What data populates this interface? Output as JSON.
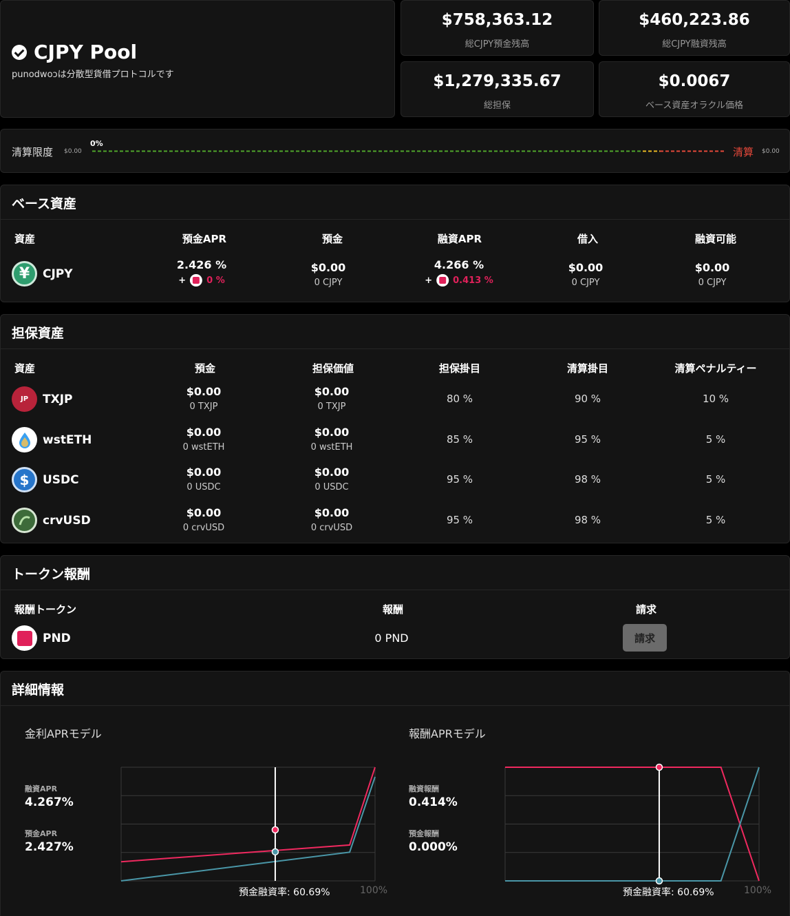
{
  "pool": {
    "name": "CJPY Pool",
    "description": "punodwoɔは分散型貨借プロトコルです"
  },
  "stats": {
    "total_supply": {
      "value": "$758,363.12",
      "label": "総CJPY預金残高"
    },
    "total_borrow": {
      "value": "$460,223.86",
      "label": "総CJPY融資残高"
    },
    "total_collateral": {
      "value": "$1,279,335.67",
      "label": "総担保"
    },
    "oracle_price": {
      "value": "$0.0067",
      "label": "ベース資産オラクル価格"
    }
  },
  "liquidation": {
    "label": "清算限度",
    "min_value": "$0.00",
    "percent": "0%",
    "end_label": "清算",
    "max_value": "$0.00"
  },
  "base_asset": {
    "title": "ベース資産",
    "headers": [
      "資産",
      "預金APR",
      "預金",
      "融資APR",
      "借入",
      "融資可能"
    ],
    "row": {
      "symbol": "CJPY",
      "icon": "yen-coin-icon",
      "supply_apr": "2.426 %",
      "supply_reward_prefix": "+",
      "supply_reward": "0 %",
      "supply_usd": "$0.00",
      "supply_amount": "0 CJPY",
      "borrow_apr": "4.266 %",
      "borrow_reward_prefix": "+",
      "borrow_reward": "0.413 %",
      "borrow_usd": "$0.00",
      "borrow_amount": "0 CJPY",
      "available_usd": "$0.00",
      "available_amount": "0 CJPY"
    }
  },
  "collateral": {
    "title": "担保資産",
    "headers": [
      "資産",
      "預金",
      "担保価値",
      "担保掛目",
      "清算掛目",
      "清算ペナルティー"
    ],
    "rows": [
      {
        "symbol": "TXJP",
        "deposit_usd": "$0.00",
        "deposit_amount": "0 TXJP",
        "value_usd": "$0.00",
        "value_amount": "0 TXJP",
        "cf": "80 %",
        "lf": "90 %",
        "penalty": "10 %"
      },
      {
        "symbol": "wstETH",
        "deposit_usd": "$0.00",
        "deposit_amount": "0 wstETH",
        "value_usd": "$0.00",
        "value_amount": "0 wstETH",
        "cf": "85 %",
        "lf": "95 %",
        "penalty": "5 %"
      },
      {
        "symbol": "USDC",
        "deposit_usd": "$0.00",
        "deposit_amount": "0 USDC",
        "value_usd": "$0.00",
        "value_amount": "0 USDC",
        "cf": "95 %",
        "lf": "98 %",
        "penalty": "5 %"
      },
      {
        "symbol": "crvUSD",
        "deposit_usd": "$0.00",
        "deposit_amount": "0 crvUSD",
        "value_usd": "$0.00",
        "value_amount": "0 crvUSD",
        "cf": "95 %",
        "lf": "98 %",
        "penalty": "5 %"
      }
    ]
  },
  "rewards": {
    "title": "トークン報酬",
    "headers": [
      "報酬トークン",
      "報酬",
      "請求"
    ],
    "row": {
      "symbol": "PND",
      "amount": "0 PND",
      "claim_label": "請求"
    }
  },
  "details": {
    "title": "詳細情報",
    "interest_chart": {
      "title": "金利APRモデル",
      "borrow_label": "融資APR",
      "borrow_value": "4.267%",
      "supply_label": "預金APR",
      "supply_value": "2.427%",
      "utilization_label": "預金融資率: 60.69%",
      "x_max_label": "100%"
    },
    "reward_chart": {
      "title": "報酬APRモデル",
      "borrow_label": "融資報酬",
      "borrow_value": "0.414%",
      "supply_label": "預金報酬",
      "supply_value": "0.000%",
      "utilization_label": "預金融資率: 60.69%",
      "x_max_label": "100%"
    }
  },
  "colors": {
    "borrow_line": "#f0295f",
    "supply_line": "#4a97a8",
    "liq_safe": "#4fa52a",
    "liq_warn": "#e8b823",
    "liq_danger": "#e5483a"
  },
  "chart_data": [
    {
      "type": "line",
      "title": "金利APRモデル",
      "xlabel": "預金融資率",
      "x": [
        0,
        90,
        100
      ],
      "xlim": [
        0,
        100
      ],
      "current_x": 60.69,
      "series": [
        {
          "name": "融資APR",
          "x": [
            0,
            90,
            100
          ],
          "values": [
            1.6,
            3.0,
            9.5
          ],
          "current": 4.267
        },
        {
          "name": "預金APR",
          "x": [
            0,
            90,
            100
          ],
          "values": [
            0,
            2.4,
            8.7
          ],
          "current": 2.427
        }
      ],
      "ylim": [
        0,
        9.5
      ],
      "grid": true
    },
    {
      "type": "line",
      "title": "報酬APRモデル",
      "xlabel": "預金融資率",
      "xlim": [
        0,
        100
      ],
      "current_x": 60.69,
      "series": [
        {
          "name": "融資報酬",
          "x": [
            0,
            85,
            100
          ],
          "values": [
            0.414,
            0.414,
            0
          ],
          "current": 0.414
        },
        {
          "name": "預金報酬",
          "x": [
            0,
            85,
            100
          ],
          "values": [
            0,
            0,
            0.414
          ],
          "current": 0.0
        }
      ],
      "ylim": [
        0,
        0.414
      ],
      "grid": true
    }
  ]
}
